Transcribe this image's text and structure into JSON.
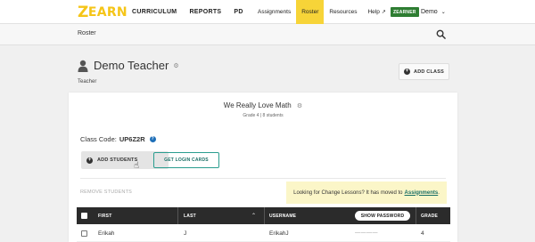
{
  "nav": {
    "logo_z": "Z",
    "logo_rest": "EARN",
    "main": [
      "CURRICULUM",
      "REPORTS",
      "PD"
    ],
    "right": [
      "Assignments",
      "Roster",
      "Resources",
      "Help"
    ],
    "active_item": "Roster",
    "badge": "ZEARNER",
    "user": "Demo"
  },
  "rosterbar": {
    "label": "Roster"
  },
  "teacher": {
    "name": "Demo Teacher",
    "role": "Teacher"
  },
  "add_class_label": "ADD CLASS",
  "class": {
    "title": "We Really Love Math",
    "meta": "Grade 4 | 8 students",
    "code_label": "Class Code:",
    "code": "UP6Z2R"
  },
  "buttons": {
    "add_students": "ADD STUDENTS",
    "login_cards": "GET LOGIN CARDS",
    "remove_students": "REMOVE STUDENTS",
    "show_password": "SHOW PASSWORD"
  },
  "notice": {
    "text": "Looking for Change Lessons? It has moved to",
    "link": "Assignments",
    "end": "."
  },
  "table": {
    "headers": {
      "first": "FIRST",
      "last": "LAST",
      "username": "USERNAME",
      "grade": "GRADE"
    },
    "rows": [
      {
        "first": "Erikah",
        "last": "J",
        "username": "ErikahJ",
        "password": "————",
        "grade": "4"
      }
    ]
  },
  "colors": {
    "accent": "#f7d438",
    "brand": "#f5c518",
    "teal": "#2a9d8f",
    "header_dark": "#2b2b2b"
  }
}
